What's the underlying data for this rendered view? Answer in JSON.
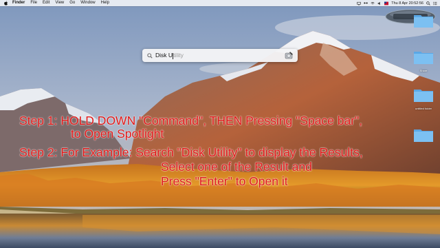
{
  "menubar": {
    "app_name": "Finder",
    "menus": [
      "File",
      "Edit",
      "View",
      "Go",
      "Window",
      "Help"
    ],
    "clock": "Thu 8 Apr  20:52:56"
  },
  "spotlight": {
    "typed_text": "Disk U",
    "suggestion_text": "tility",
    "app_icon": "disk-utility-icon"
  },
  "desktop": {
    "items": [
      {
        "label": "",
        "icon": "folder-icon"
      },
      {
        "label": "Share",
        "icon": "folder-icon"
      },
      {
        "label": "untitled folder",
        "icon": "folder-icon"
      },
      {
        "label": "",
        "icon": "folder-icon"
      }
    ]
  },
  "overlay": {
    "line1": "Step 1: HOLD DOWN \"Command\", THEN Pressing \"Space bar\",",
    "line2": "to Open Spotlight",
    "line3": "Step 2: For Example: Search \"Disk Utility\" to display the Results,",
    "line4": "Select one of the Result and",
    "line5": "Press \"Enter\" to Open it",
    "color": "#e01818"
  }
}
